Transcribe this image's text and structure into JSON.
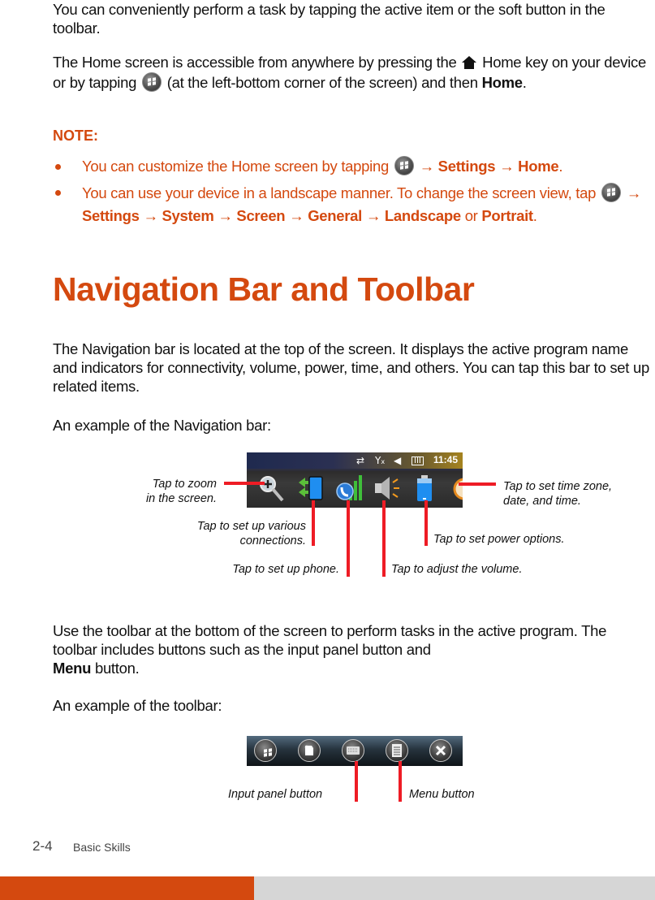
{
  "intro": {
    "p1": "You can conveniently perform a task by tapping the active item or the soft button in the toolbar.",
    "p2_a": "The Home screen is accessible from anywhere by pressing the",
    "p2_b": "Home key on your device or by tapping",
    "p2_c": "(at the left-bottom corner of the screen) and then",
    "p2_bold": "Home",
    "p2_end": "."
  },
  "note": {
    "title": "NOTE:",
    "bullets": [
      {
        "a": "You can customize the Home screen by tapping",
        "arrow": "→",
        "b1": "Settings",
        "b2": "Home",
        "end": "."
      },
      {
        "a": "You can use your device in a landscape manner.  To change the screen view, tap",
        "arrow": "→",
        "b1": "Settings",
        "b2": "System",
        "b3": "Screen",
        "b4": "General",
        "b5": "Landscape",
        "or": "or",
        "b6": "Portrait",
        "end": "."
      }
    ]
  },
  "section": {
    "heading": "Navigation Bar and Toolbar",
    "p1": "The Navigation bar is located at the top of the screen. It displays the active program name and indicators for connectivity, volume, power, time, and others. You can tap this bar to set up related items.",
    "p2": "An example of the Navigation bar:",
    "p3_a": "Use the toolbar at the bottom of the screen to perform tasks in the active program. The toolbar includes buttons such as the input panel button and",
    "p3_bold": "Menu",
    "p3_b": "button.",
    "p4": "An example of the toolbar:"
  },
  "navbar_figure": {
    "time": "11:45",
    "status_icons": [
      "data-sync-icon",
      "no-signal-icon",
      "speaker-icon",
      "battery-icon"
    ],
    "icons": [
      "zoom-icon",
      "connections-icon",
      "phone-icon",
      "volume-icon",
      "battery-icon",
      "clock-icon"
    ],
    "captions": {
      "zoom_line1": "Tap to zoom",
      "zoom_line2": "in the screen.",
      "connections_line1": "Tap to set up various",
      "connections_line2": "connections.",
      "phone": "Tap to set up phone.",
      "volume": "Tap to adjust the volume.",
      "power": "Tap to set power options.",
      "time_line1": "Tap to set time zone,",
      "time_line2": "date, and time."
    }
  },
  "toolbar_figure": {
    "buttons": [
      "start-icon",
      "new-document-icon",
      "keyboard-icon",
      "menu-icon",
      "close-icon"
    ],
    "captions": {
      "input_panel": "Input panel button",
      "menu": "Menu button"
    }
  },
  "footer": {
    "page_number": "2-4",
    "section": "Basic Skills",
    "accent_color": "#d4490f",
    "bar_gray": "#d6d6d6"
  }
}
